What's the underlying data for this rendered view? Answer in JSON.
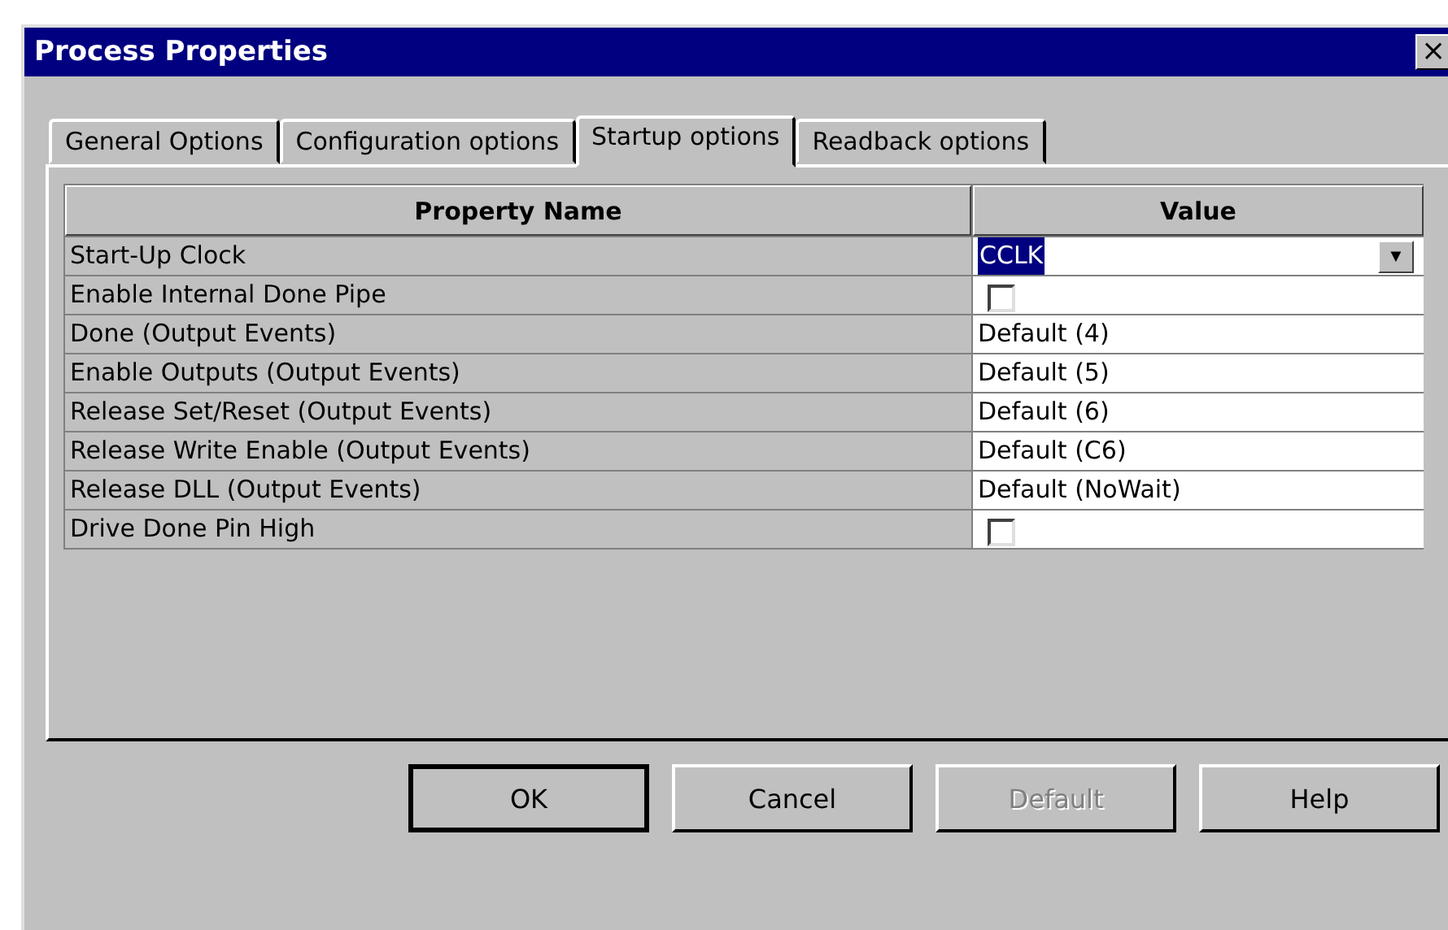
{
  "window": {
    "title": "Process Properties",
    "close": "×"
  },
  "tabs": [
    {
      "label": "General Options",
      "selected": false
    },
    {
      "label": "Configuration options",
      "selected": false
    },
    {
      "label": "Startup options",
      "selected": true
    },
    {
      "label": "Readback options",
      "selected": false
    }
  ],
  "table": {
    "columns": [
      "Property Name",
      "Value"
    ],
    "rows": [
      {
        "name": "Start-Up Clock",
        "kind": "dropdown",
        "value": "CCLK",
        "arrow": "▼"
      },
      {
        "name": "Enable Internal Done Pipe",
        "kind": "checkbox",
        "checked": false
      },
      {
        "name": "Done (Output Events)",
        "kind": "text",
        "value": "Default (4)"
      },
      {
        "name": "Enable Outputs (Output Events)",
        "kind": "text",
        "value": "Default (5)"
      },
      {
        "name": "Release Set/Reset (Output Events)",
        "kind": "text",
        "value": "Default (6)"
      },
      {
        "name": "Release Write Enable (Output Events)",
        "kind": "text",
        "value": "Default (C6)"
      },
      {
        "name": "Release DLL (Output Events)",
        "kind": "text",
        "value": "Default (NoWait)"
      },
      {
        "name": "Drive Done Pin High",
        "kind": "checkbox",
        "checked": false
      }
    ]
  },
  "buttons": [
    {
      "label": "OK",
      "disabled": false,
      "default": true
    },
    {
      "label": "Cancel",
      "disabled": false,
      "default": false
    },
    {
      "label": "Default",
      "disabled": true,
      "default": false
    },
    {
      "label": "Help",
      "disabled": false,
      "default": false
    }
  ]
}
